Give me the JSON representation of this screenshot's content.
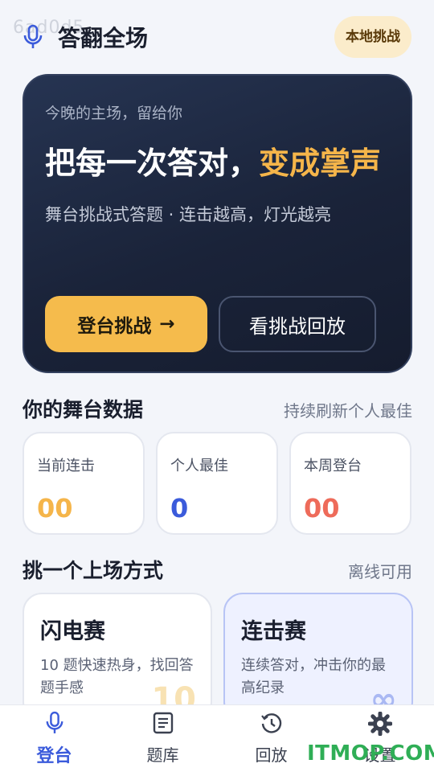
{
  "watermark": "6ad0d5",
  "header": {
    "title": "答翻全场",
    "local_challenge": "本地挑战"
  },
  "hero": {
    "subtitle": "今晚的主场，留给你",
    "title_main": "把每一次答对，",
    "title_accent": "变成掌声",
    "description": "舞台挑战式答题 · 连击越高，灯光越亮",
    "primary_button": "登台挑战",
    "primary_arrow": "→",
    "secondary_button": "看挑战回放"
  },
  "stats_section": {
    "title": "你的舞台数据",
    "note": "持续刷新个人最佳",
    "cards": [
      {
        "label": "当前连击",
        "value": "00",
        "color": "#f5b54a"
      },
      {
        "label": "个人最佳",
        "value": "0",
        "color": "#3b5bdb"
      },
      {
        "label": "本周登台",
        "value": "00",
        "color": "#ee6b5a"
      }
    ]
  },
  "modes_section": {
    "title": "挑一个上场方式",
    "note": "离线可用",
    "cards": [
      {
        "name": "闪电赛",
        "description": "10 题快速热身，找回答题手感",
        "badge": "10",
        "badge_color": "#f8e2b3"
      },
      {
        "name": "连击赛",
        "description": "连续答对，冲击你的最高纪录",
        "badge": "∞",
        "badge_color": "#a9b8f3"
      }
    ]
  },
  "tabbar": {
    "items": [
      {
        "label": "登台",
        "icon": "mic-icon"
      },
      {
        "label": "题库",
        "icon": "book-icon"
      },
      {
        "label": "回放",
        "icon": "history-icon"
      },
      {
        "label": "设置",
        "icon": "gear-icon"
      }
    ]
  },
  "brand_overlay": "ITMOP.COM",
  "colors": {
    "accent": "#3b5bdb",
    "gold": "#f5b54a",
    "hero_bg": "#1a2339"
  }
}
